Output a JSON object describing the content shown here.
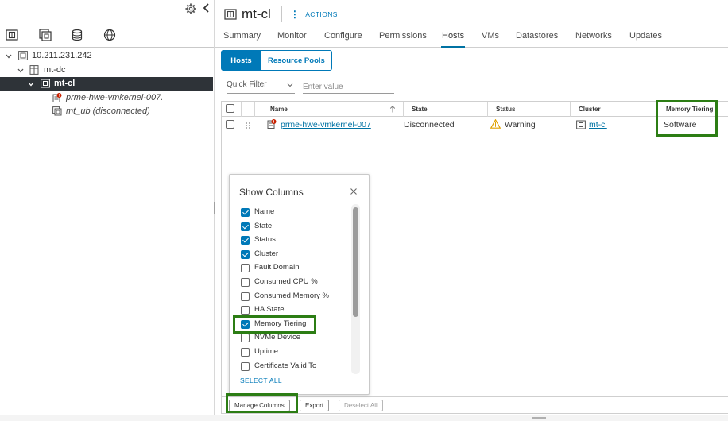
{
  "navigator": {
    "tree": [
      {
        "label": "10.211.231.242",
        "icon": "vcenter-icon",
        "expanded": true
      },
      {
        "label": "mt-dc",
        "icon": "datacenter-icon",
        "expanded": true
      },
      {
        "label": "mt-cl",
        "icon": "cluster-icon",
        "expanded": true,
        "selected": true
      },
      {
        "label": "prme-hwe-vmkernel-007.",
        "icon": "host-error-icon"
      },
      {
        "label": "mt_ub (disconnected)",
        "icon": "vm-icon"
      }
    ]
  },
  "object": {
    "name": "mt-cl",
    "actions_label": "ACTIONS"
  },
  "tabs": [
    "Summary",
    "Monitor",
    "Configure",
    "Permissions",
    "Hosts",
    "VMs",
    "Datastores",
    "Networks",
    "Updates"
  ],
  "active_tab": "Hosts",
  "subtabs": {
    "hosts": "Hosts",
    "resource_pools": "Resource Pools"
  },
  "filter": {
    "label": "Quick Filter",
    "placeholder": "Enter value"
  },
  "grid": {
    "columns": [
      "Name",
      "State",
      "Status",
      "Cluster",
      "Memory Tiering"
    ],
    "rows": [
      {
        "name": "prme-hwe-vmkernel-007",
        "state": "Disconnected",
        "status": "Warning",
        "cluster": "mt-cl",
        "memory_tiering": "Software"
      }
    ],
    "footer": {
      "manage_columns": "Manage Columns",
      "export": "Export",
      "deselect_all": "Deselect All"
    }
  },
  "show_columns": {
    "title": "Show Columns",
    "items": [
      {
        "label": "Name",
        "checked": true
      },
      {
        "label": "State",
        "checked": true
      },
      {
        "label": "Status",
        "checked": true
      },
      {
        "label": "Cluster",
        "checked": true
      },
      {
        "label": "Fault Domain",
        "checked": false
      },
      {
        "label": "Consumed CPU %",
        "checked": false
      },
      {
        "label": "Consumed Memory %",
        "checked": false
      },
      {
        "label": "HA State",
        "checked": false
      },
      {
        "label": "Memory Tiering",
        "checked": true
      },
      {
        "label": "NVMe Device",
        "checked": false
      },
      {
        "label": "Uptime",
        "checked": false
      },
      {
        "label": "Certificate Valid To",
        "checked": false
      }
    ],
    "select_all": "SELECT ALL"
  },
  "colors": {
    "accent": "#0079b8",
    "highlight": "#2c7d14",
    "selected_row": "#2e3338",
    "warning": "#e0a100",
    "error": "#c92100"
  }
}
